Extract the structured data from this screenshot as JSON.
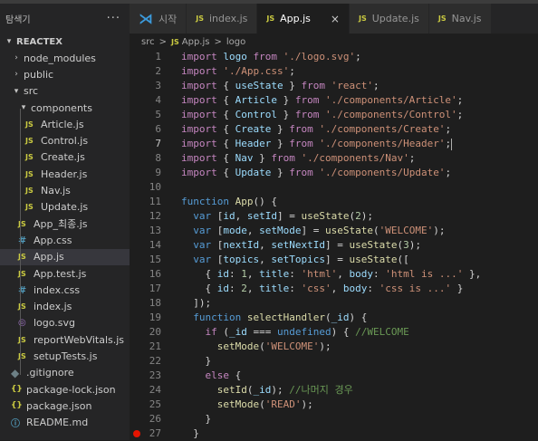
{
  "explorer": {
    "title": "탐색기",
    "more": "···",
    "project": "REACTEX",
    "tree": [
      {
        "label": "node_modules",
        "depth": 1,
        "kind": "folder",
        "open": false
      },
      {
        "label": "public",
        "depth": 1,
        "kind": "folder",
        "open": false
      },
      {
        "label": "src",
        "depth": 1,
        "kind": "folder",
        "open": true
      },
      {
        "label": "components",
        "depth": 2,
        "kind": "folder",
        "open": true
      },
      {
        "label": "Article.js",
        "depth": 3,
        "kind": "js"
      },
      {
        "label": "Control.js",
        "depth": 3,
        "kind": "js"
      },
      {
        "label": "Create.js",
        "depth": 3,
        "kind": "js"
      },
      {
        "label": "Header.js",
        "depth": 3,
        "kind": "js"
      },
      {
        "label": "Nav.js",
        "depth": 3,
        "kind": "js"
      },
      {
        "label": "Update.js",
        "depth": 3,
        "kind": "js"
      },
      {
        "label": "App_최종.js",
        "depth": 2,
        "kind": "js"
      },
      {
        "label": "App.css",
        "depth": 2,
        "kind": "css"
      },
      {
        "label": "App.js",
        "depth": 2,
        "kind": "js",
        "active": true
      },
      {
        "label": "App.test.js",
        "depth": 2,
        "kind": "js"
      },
      {
        "label": "index.css",
        "depth": 2,
        "kind": "css"
      },
      {
        "label": "index.js",
        "depth": 2,
        "kind": "js"
      },
      {
        "label": "logo.svg",
        "depth": 2,
        "kind": "svg"
      },
      {
        "label": "reportWebVitals.js",
        "depth": 2,
        "kind": "js"
      },
      {
        "label": "setupTests.js",
        "depth": 2,
        "kind": "js"
      },
      {
        "label": ".gitignore",
        "depth": 1,
        "kind": "git"
      },
      {
        "label": "package-lock.json",
        "depth": 1,
        "kind": "json"
      },
      {
        "label": "package.json",
        "depth": 1,
        "kind": "json"
      },
      {
        "label": "README.md",
        "depth": 1,
        "kind": "info"
      }
    ]
  },
  "tabs": [
    {
      "label": "시작",
      "kind": "vscode"
    },
    {
      "label": "index.js",
      "kind": "js"
    },
    {
      "label": "App.js",
      "kind": "js",
      "active": true,
      "close": "×"
    },
    {
      "label": "Update.js",
      "kind": "js"
    },
    {
      "label": "Nav.js",
      "kind": "js"
    }
  ],
  "breadcrumb": {
    "folder": "src",
    "sep": ">",
    "file": "App.js",
    "symbol_sep": ">",
    "symbol": "logo"
  },
  "editor": {
    "current_line": 7,
    "breakpoint_line": 27,
    "lines": [
      {
        "n": "1",
        "tokens": [
          [
            "c",
            "import "
          ],
          [
            "v",
            "logo"
          ],
          [
            "c",
            " from "
          ],
          [
            "s",
            "'./logo.svg'"
          ],
          [
            "p",
            ";"
          ]
        ]
      },
      {
        "n": "2",
        "tokens": [
          [
            "c",
            "import "
          ],
          [
            "s",
            "'./App.css'"
          ],
          [
            "p",
            ";"
          ]
        ]
      },
      {
        "n": "3",
        "tokens": [
          [
            "c",
            "import "
          ],
          [
            "p",
            "{ "
          ],
          [
            "v",
            "useState"
          ],
          [
            "p",
            " } "
          ],
          [
            "c",
            "from "
          ],
          [
            "s",
            "'react'"
          ],
          [
            "p",
            ";"
          ]
        ]
      },
      {
        "n": "4",
        "tokens": [
          [
            "c",
            "import "
          ],
          [
            "p",
            "{ "
          ],
          [
            "v",
            "Article"
          ],
          [
            "p",
            " } "
          ],
          [
            "c",
            "from "
          ],
          [
            "s",
            "'./components/Article'"
          ],
          [
            "p",
            ";"
          ]
        ]
      },
      {
        "n": "5",
        "tokens": [
          [
            "c",
            "import "
          ],
          [
            "p",
            "{ "
          ],
          [
            "v",
            "Control"
          ],
          [
            "p",
            " } "
          ],
          [
            "c",
            "from "
          ],
          [
            "s",
            "'./components/Control'"
          ],
          [
            "p",
            ";"
          ]
        ]
      },
      {
        "n": "6",
        "tokens": [
          [
            "c",
            "import "
          ],
          [
            "p",
            "{ "
          ],
          [
            "v",
            "Create"
          ],
          [
            "p",
            " } "
          ],
          [
            "c",
            "from "
          ],
          [
            "s",
            "'./components/Create'"
          ],
          [
            "p",
            ";"
          ]
        ]
      },
      {
        "n": "7",
        "tokens": [
          [
            "c",
            "import "
          ],
          [
            "p",
            "{ "
          ],
          [
            "v",
            "Header"
          ],
          [
            "p",
            " } "
          ],
          [
            "c",
            "from "
          ],
          [
            "s",
            "'./components/Header'"
          ],
          [
            "p",
            ";"
          ]
        ]
      },
      {
        "n": "8",
        "tokens": [
          [
            "c",
            "import "
          ],
          [
            "p",
            "{ "
          ],
          [
            "v",
            "Nav"
          ],
          [
            "p",
            " } "
          ],
          [
            "c",
            "from "
          ],
          [
            "s",
            "'./components/Nav'"
          ],
          [
            "p",
            ";"
          ]
        ]
      },
      {
        "n": "9",
        "tokens": [
          [
            "c",
            "import "
          ],
          [
            "p",
            "{ "
          ],
          [
            "v",
            "Update"
          ],
          [
            "p",
            " } "
          ],
          [
            "c",
            "from "
          ],
          [
            "s",
            "'./components/Update'"
          ],
          [
            "p",
            ";"
          ]
        ]
      },
      {
        "n": "10",
        "tokens": []
      },
      {
        "n": "11",
        "tokens": [
          [
            "k",
            "function "
          ],
          [
            "f",
            "App"
          ],
          [
            "p",
            "() {"
          ]
        ]
      },
      {
        "n": "12",
        "tokens": [
          [
            "p",
            "  "
          ],
          [
            "k",
            "var "
          ],
          [
            "p",
            "["
          ],
          [
            "v",
            "id"
          ],
          [
            "p",
            ", "
          ],
          [
            "v",
            "setId"
          ],
          [
            "p",
            "] = "
          ],
          [
            "f",
            "useState"
          ],
          [
            "p",
            "("
          ],
          [
            "n",
            "2"
          ],
          [
            "p",
            ");"
          ]
        ]
      },
      {
        "n": "13",
        "tokens": [
          [
            "p",
            "  "
          ],
          [
            "k",
            "var "
          ],
          [
            "p",
            "["
          ],
          [
            "v",
            "mode"
          ],
          [
            "p",
            ", "
          ],
          [
            "v",
            "setMode"
          ],
          [
            "p",
            "] = "
          ],
          [
            "f",
            "useState"
          ],
          [
            "p",
            "("
          ],
          [
            "s",
            "'WELCOME'"
          ],
          [
            "p",
            ");"
          ]
        ]
      },
      {
        "n": "14",
        "tokens": [
          [
            "p",
            "  "
          ],
          [
            "k",
            "var "
          ],
          [
            "p",
            "["
          ],
          [
            "v",
            "nextId"
          ],
          [
            "p",
            ", "
          ],
          [
            "v",
            "setNextId"
          ],
          [
            "p",
            "] = "
          ],
          [
            "f",
            "useState"
          ],
          [
            "p",
            "("
          ],
          [
            "n",
            "3"
          ],
          [
            "p",
            ");"
          ]
        ]
      },
      {
        "n": "15",
        "tokens": [
          [
            "p",
            "  "
          ],
          [
            "k",
            "var "
          ],
          [
            "p",
            "["
          ],
          [
            "v",
            "topics"
          ],
          [
            "p",
            ", "
          ],
          [
            "v",
            "setTopics"
          ],
          [
            "p",
            "] = "
          ],
          [
            "f",
            "useState"
          ],
          [
            "p",
            "(["
          ]
        ]
      },
      {
        "n": "16",
        "tokens": [
          [
            "p",
            "    { "
          ],
          [
            "v",
            "id"
          ],
          [
            "p",
            ": "
          ],
          [
            "n",
            "1"
          ],
          [
            "p",
            ", "
          ],
          [
            "v",
            "title"
          ],
          [
            "p",
            ": "
          ],
          [
            "s",
            "'html'"
          ],
          [
            "p",
            ", "
          ],
          [
            "v",
            "body"
          ],
          [
            "p",
            ": "
          ],
          [
            "s",
            "'html is ...'"
          ],
          [
            "p",
            " },"
          ]
        ]
      },
      {
        "n": "17",
        "tokens": [
          [
            "p",
            "    { "
          ],
          [
            "v",
            "id"
          ],
          [
            "p",
            ": "
          ],
          [
            "n",
            "2"
          ],
          [
            "p",
            ", "
          ],
          [
            "v",
            "title"
          ],
          [
            "p",
            ": "
          ],
          [
            "s",
            "'css'"
          ],
          [
            "p",
            ", "
          ],
          [
            "v",
            "body"
          ],
          [
            "p",
            ": "
          ],
          [
            "s",
            "'css is ...'"
          ],
          [
            "p",
            " }"
          ]
        ]
      },
      {
        "n": "18",
        "tokens": [
          [
            "p",
            "  ]);"
          ]
        ]
      },
      {
        "n": "19",
        "tokens": [
          [
            "p",
            "  "
          ],
          [
            "k",
            "function "
          ],
          [
            "f",
            "selectHandler"
          ],
          [
            "p",
            "("
          ],
          [
            "v",
            "_id"
          ],
          [
            "p",
            ") {"
          ]
        ]
      },
      {
        "n": "20",
        "tokens": [
          [
            "p",
            "    "
          ],
          [
            "c",
            "if "
          ],
          [
            "p",
            "("
          ],
          [
            "v",
            "_id"
          ],
          [
            "p",
            " === "
          ],
          [
            "k",
            "undefined"
          ],
          [
            "p",
            ") { "
          ],
          [
            "cm",
            "//WELCOME"
          ]
        ]
      },
      {
        "n": "21",
        "tokens": [
          [
            "p",
            "      "
          ],
          [
            "f",
            "setMode"
          ],
          [
            "p",
            "("
          ],
          [
            "s",
            "'WELCOME'"
          ],
          [
            "p",
            ");"
          ]
        ]
      },
      {
        "n": "22",
        "tokens": [
          [
            "p",
            "    }"
          ]
        ]
      },
      {
        "n": "23",
        "tokens": [
          [
            "p",
            "    "
          ],
          [
            "c",
            "else "
          ],
          [
            "p",
            "{"
          ]
        ]
      },
      {
        "n": "24",
        "tokens": [
          [
            "p",
            "      "
          ],
          [
            "f",
            "setId"
          ],
          [
            "p",
            "("
          ],
          [
            "v",
            "_id"
          ],
          [
            "p",
            "); "
          ],
          [
            "cm",
            "//나머지 경우"
          ]
        ]
      },
      {
        "n": "25",
        "tokens": [
          [
            "p",
            "      "
          ],
          [
            "f",
            "setMode"
          ],
          [
            "p",
            "("
          ],
          [
            "s",
            "'READ'"
          ],
          [
            "p",
            ");"
          ]
        ]
      },
      {
        "n": "26",
        "tokens": [
          [
            "p",
            "    }"
          ]
        ]
      },
      {
        "n": "27",
        "tokens": [
          [
            "p",
            "  }"
          ]
        ]
      }
    ]
  },
  "colors": {
    "keyword": "#569cd6",
    "control": "#c586c0",
    "string": "#ce9178",
    "variable": "#9cdcfe",
    "function": "#dcdcaa",
    "number": "#b5cea8",
    "comment": "#6a9955",
    "breakpoint": "#e51400"
  }
}
